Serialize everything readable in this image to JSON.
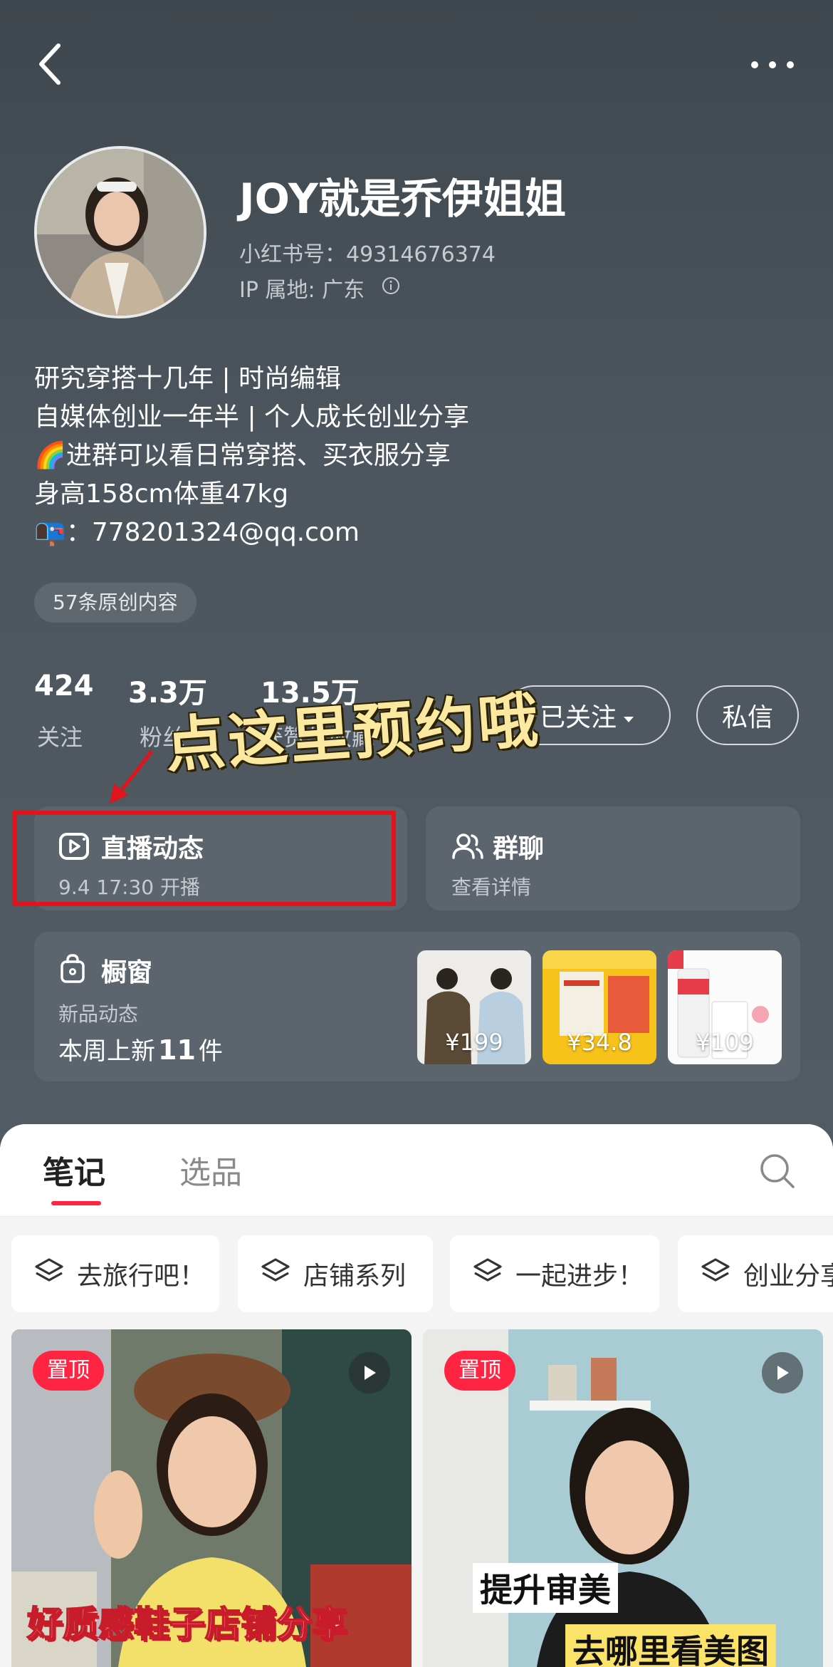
{
  "profile": {
    "nickname": "JOY就是乔伊姐姐",
    "red_id": "小红书号：49314676374",
    "ip_location": "IP 属地: 广东",
    "bio_lines": [
      "研究穿搭十几年 | 时尚编辑",
      "自媒体创业一年半  | 个人成长创业分享",
      "🌈进群可以看日常穿搭、买衣服分享",
      "身高158cm体重47kg",
      "📭：778201324@qq.com"
    ],
    "original_tag": "57条原创内容"
  },
  "stats": {
    "following": {
      "value": "424",
      "label": "关注"
    },
    "followers": {
      "value": "3.3万",
      "label": "粉丝"
    },
    "likes": {
      "value": "13.5万",
      "label": "获赞与收藏"
    }
  },
  "actions": {
    "follow_label": "已关注",
    "message_label": "私信"
  },
  "annotation": {
    "text": "点这里预约哦"
  },
  "cards": {
    "live": {
      "title": "直播动态",
      "subtitle": "9.4 17:30 开播"
    },
    "group": {
      "title": "群聊",
      "subtitle": "查看详情"
    },
    "shop": {
      "title": "橱窗",
      "subtitle": "新品动态",
      "new_prefix": "本周上新",
      "new_count": "11",
      "new_suffix": "件",
      "items": [
        {
          "price": "¥199"
        },
        {
          "price": "¥34.8"
        },
        {
          "price": "¥109"
        }
      ]
    }
  },
  "tabs": {
    "notes": "笔记",
    "picks": "选品"
  },
  "collections": [
    "去旅行吧！",
    "店铺系列",
    "一起进步！",
    "创业分享"
  ],
  "notes": [
    {
      "badge": "置顶",
      "caption": "好质感鞋子店铺分享"
    },
    {
      "badge": "置顶",
      "caption_line1": "提升审美",
      "caption_line2": "去哪里看美图"
    }
  ],
  "colors": {
    "accent": "#ff2442",
    "header_bg": "#4a535b",
    "highlight_box": "#e0141a",
    "annotation_text": "#fbe9a2"
  }
}
